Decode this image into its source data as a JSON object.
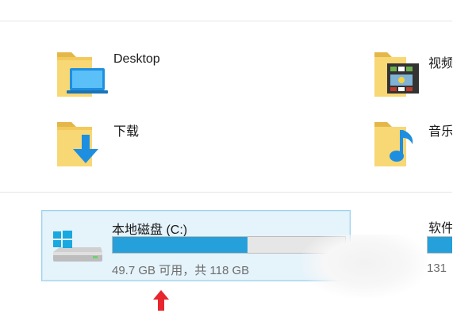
{
  "folders": [
    {
      "id": "desktop",
      "label": "Desktop",
      "icon": "desktop-folder-icon"
    },
    {
      "id": "videos",
      "label": "视频",
      "icon": "videos-folder-icon"
    },
    {
      "id": "downloads",
      "label": "下载",
      "icon": "downloads-folder-icon"
    },
    {
      "id": "music",
      "label": "音乐",
      "icon": "music-folder-icon"
    }
  ],
  "drives": [
    {
      "name": "本地磁盘 (C:)",
      "info": "49.7 GB 可用，共 118 GB",
      "used_fraction": 0.579,
      "icon": "windows-drive-icon",
      "selected": true
    },
    {
      "name": "软件",
      "info": "131",
      "icon": "drive-icon"
    }
  ],
  "colors": {
    "selection_fill": "#e5f3fb",
    "selection_border": "#9fd1ee",
    "bar_fill": "#26a0da",
    "bar_track": "#e6e6e6",
    "arrow": "#e8262d",
    "folder": "#f8d775",
    "info_text": "#6d6d6d"
  }
}
